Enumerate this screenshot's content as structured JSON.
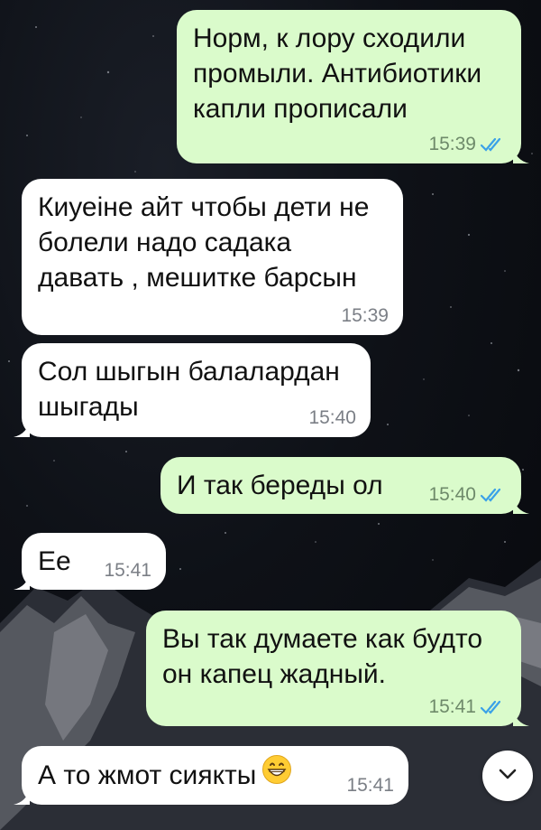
{
  "messages": [
    {
      "direction": "out",
      "text": "Норм, к лору сходили\nпромыли. Антибиотики\nкапли прописали",
      "time": "15:39",
      "status_icon": "double-check-icon"
    },
    {
      "direction": "in",
      "text": "Киуеіне айт чтобы дети не\nболели надо садака\nдавать , мешитке барсын",
      "time": "15:39"
    },
    {
      "direction": "in",
      "text": "Сол шыгын балалардан\nшыгады",
      "time": "15:40"
    },
    {
      "direction": "out",
      "text": "И так береды ол",
      "time": "15:40",
      "status_icon": "double-check-icon"
    },
    {
      "direction": "in",
      "text": "Ее",
      "time": "15:41"
    },
    {
      "direction": "out",
      "text": "Вы так думаете как будто\nон капец жадный.",
      "time": "15:41",
      "status_icon": "double-check-icon"
    },
    {
      "direction": "in",
      "text": "А то жмот сиякты",
      "time": "15:41",
      "emoji_icon": "grinning-face-icon"
    }
  ],
  "scroll_button": {
    "icon": "chevron-down-icon"
  },
  "colors": {
    "outgoing_bubble": "#dafbcb",
    "incoming_bubble": "#ffffff",
    "read_check": "#3aa1e8",
    "wallpaper": "#0b0d12"
  }
}
